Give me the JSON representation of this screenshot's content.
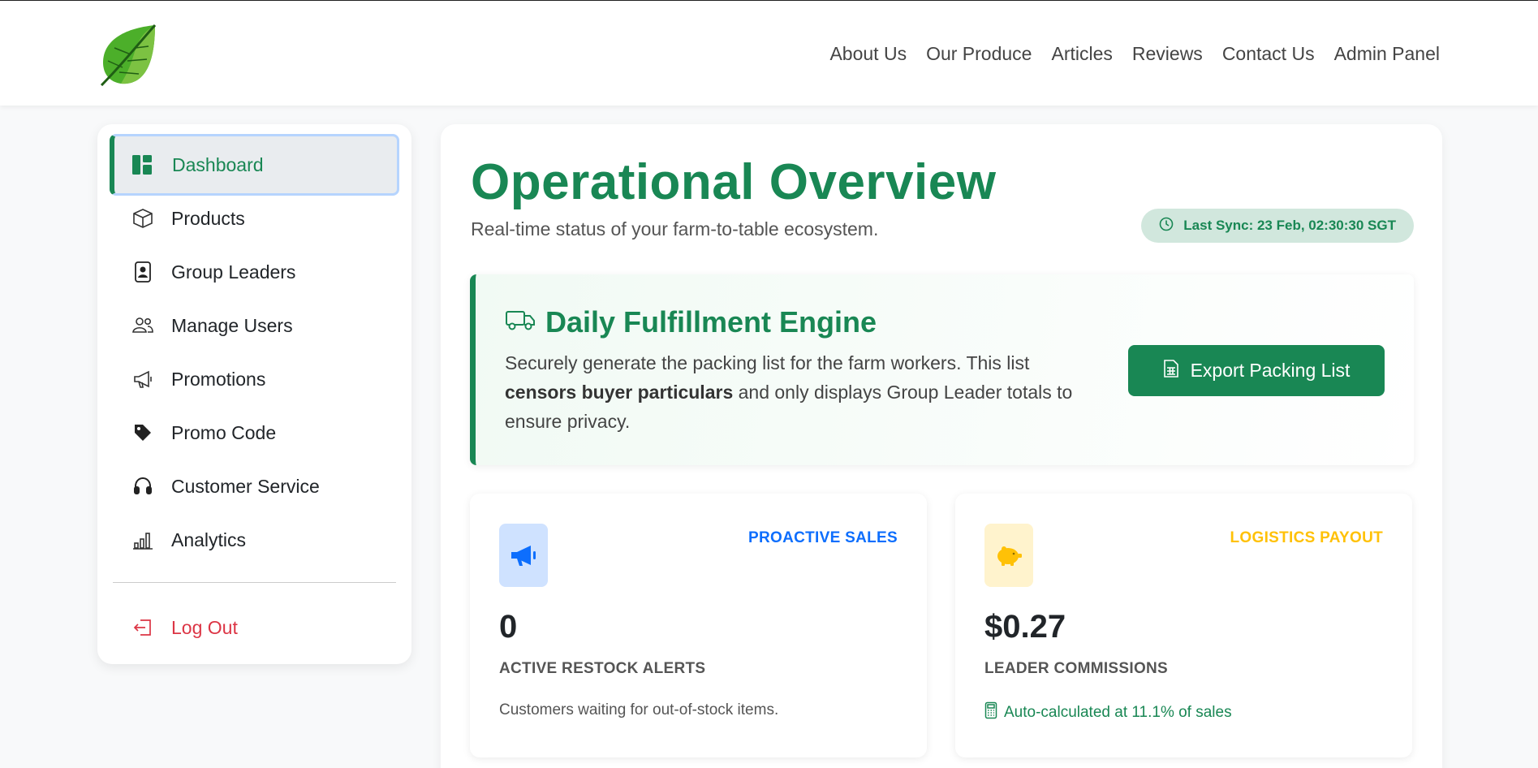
{
  "colors": {
    "brand_green": "#198754",
    "blue": "#0d6efd",
    "amber": "#ffc107",
    "danger": "#dc3545"
  },
  "navbar": {
    "logo_icon": "leaf-logo",
    "links": [
      "About Us",
      "Our Produce",
      "Articles",
      "Reviews",
      "Contact Us",
      "Admin Panel"
    ]
  },
  "sidebar": {
    "items": [
      {
        "label": "Dashboard",
        "icon": "dashboard-icon",
        "active": true
      },
      {
        "label": "Products",
        "icon": "box-icon"
      },
      {
        "label": "Group Leaders",
        "icon": "person-badge-icon"
      },
      {
        "label": "Manage Users",
        "icon": "people-icon"
      },
      {
        "label": "Promotions",
        "icon": "megaphone-icon"
      },
      {
        "label": "Promo Code",
        "icon": "tag-icon"
      },
      {
        "label": "Customer Service",
        "icon": "headset-icon"
      },
      {
        "label": "Analytics",
        "icon": "bar-chart-icon"
      }
    ],
    "logout": {
      "label": "Log Out",
      "icon": "logout-icon"
    }
  },
  "main": {
    "title": "Operational Overview",
    "subtitle": "Real-time status of your farm-to-table ecosystem.",
    "sync_badge": "Last Sync: 23 Feb, 02:30:30 SGT",
    "engine": {
      "title": "Daily Fulfillment Engine",
      "desc_before": "Securely generate the packing list for the farm workers. This list ",
      "desc_bold": "censors buyer particulars",
      "desc_after": " and only displays Group Leader totals to ensure privacy.",
      "button": "Export Packing List"
    },
    "cards": [
      {
        "tag": "PROACTIVE SALES",
        "value": "0",
        "label": "ACTIVE RESTOCK ALERTS",
        "note": "Customers waiting for out-of-stock items."
      },
      {
        "tag": "LOGISTICS PAYOUT",
        "value": "$0.27",
        "label": "LEADER COMMISSIONS",
        "note": "Auto-calculated at 11.1% of sales"
      }
    ]
  }
}
